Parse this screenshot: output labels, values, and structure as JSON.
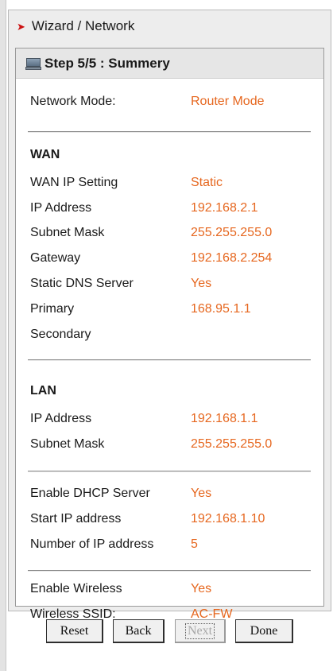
{
  "header": {
    "title": "Wizard / Network"
  },
  "step": {
    "title": "Step 5/5 : Summery"
  },
  "network_mode": {
    "label": "Network Mode:",
    "value": "Router Mode"
  },
  "wan": {
    "heading": "WAN",
    "rows": [
      {
        "label": "WAN IP Setting",
        "value": "Static"
      },
      {
        "label": "IP Address",
        "value": "192.168.2.1"
      },
      {
        "label": "Subnet Mask",
        "value": "255.255.255.0"
      },
      {
        "label": "Gateway",
        "value": "192.168.2.254"
      },
      {
        "label": "Static DNS Server",
        "value": "Yes"
      },
      {
        "label": "Primary",
        "value": "168.95.1.1"
      },
      {
        "label": "Secondary",
        "value": ""
      }
    ]
  },
  "lan": {
    "heading": "LAN",
    "rows": [
      {
        "label": "IP Address",
        "value": "192.168.1.1"
      },
      {
        "label": "Subnet Mask",
        "value": "255.255.255.0"
      }
    ]
  },
  "dhcp": {
    "rows": [
      {
        "label": "Enable DHCP Server",
        "value": "Yes"
      },
      {
        "label": "Start IP address",
        "value": "192.168.1.10"
      },
      {
        "label": "Number of IP address",
        "value": "5"
      }
    ]
  },
  "wireless": {
    "rows": [
      {
        "label": "Enable Wireless",
        "value": "Yes"
      },
      {
        "label": "Wireless SSID:",
        "value": "AC-FW"
      }
    ]
  },
  "buttons": {
    "reset": "Reset",
    "back": "Back",
    "next": "Next",
    "done": "Done"
  },
  "colors": {
    "value_text": "#e6671f",
    "header_arrow": "#cc1111"
  },
  "icons": {
    "header": "red-arrow-icon",
    "step": "computer-icon"
  }
}
